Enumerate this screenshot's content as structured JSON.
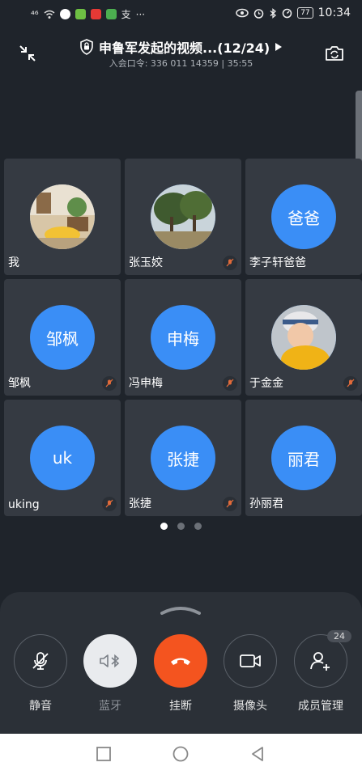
{
  "status_bar": {
    "signal": "⁴⁶",
    "time": "10:34",
    "battery": "77",
    "more": "···",
    "app_icon_colors": [
      "#ffffff",
      "#6dc043",
      "#e53935",
      "#4caf50"
    ]
  },
  "header": {
    "title": "申鲁军发起的视频...(12/24)",
    "meeting_code_label": "入会口令: ",
    "meeting_code": "336 011 14359",
    "separator": " | ",
    "duration": "35:55"
  },
  "participants": [
    {
      "name": "我",
      "avatar_text": "",
      "avatar_type": "photo-room",
      "muted": false
    },
    {
      "name": "张玉姣",
      "avatar_text": "",
      "avatar_type": "photo-trees",
      "muted": true
    },
    {
      "name": "李子轩爸爸",
      "avatar_text": "爸爸",
      "avatar_type": "initials",
      "muted": false
    },
    {
      "name": "邹枫",
      "avatar_text": "邹枫",
      "avatar_type": "initials",
      "muted": true
    },
    {
      "name": "冯申梅",
      "avatar_text": "申梅",
      "avatar_type": "initials",
      "muted": true
    },
    {
      "name": "于金金",
      "avatar_text": "",
      "avatar_type": "photo-child",
      "muted": true
    },
    {
      "name": "uking",
      "avatar_text": "uk",
      "avatar_type": "initials",
      "muted": true
    },
    {
      "name": "张捷",
      "avatar_text": "张捷",
      "avatar_type": "initials",
      "muted": true
    },
    {
      "name": "孙丽君",
      "avatar_text": "丽君",
      "avatar_type": "initials",
      "muted": false
    }
  ],
  "pager": {
    "pages": 3,
    "active": 0
  },
  "controls": {
    "mute": {
      "label": "静音",
      "icon": "mic-off-icon"
    },
    "bluetooth": {
      "label": "蓝牙",
      "icon": "speaker-bluetooth-icon"
    },
    "hangup": {
      "label": "挂断",
      "icon": "phone-hangup-icon"
    },
    "camera": {
      "label": "摄像头",
      "icon": "video-camera-icon"
    },
    "members": {
      "label": "成员管理",
      "icon": "add-member-icon",
      "count": "24"
    }
  },
  "colors": {
    "background": "#1f242b",
    "tile": "#353a42",
    "avatar_blue": "#3a8ef6",
    "hangup_orange": "#f4541f",
    "panel": "#2b3037"
  }
}
